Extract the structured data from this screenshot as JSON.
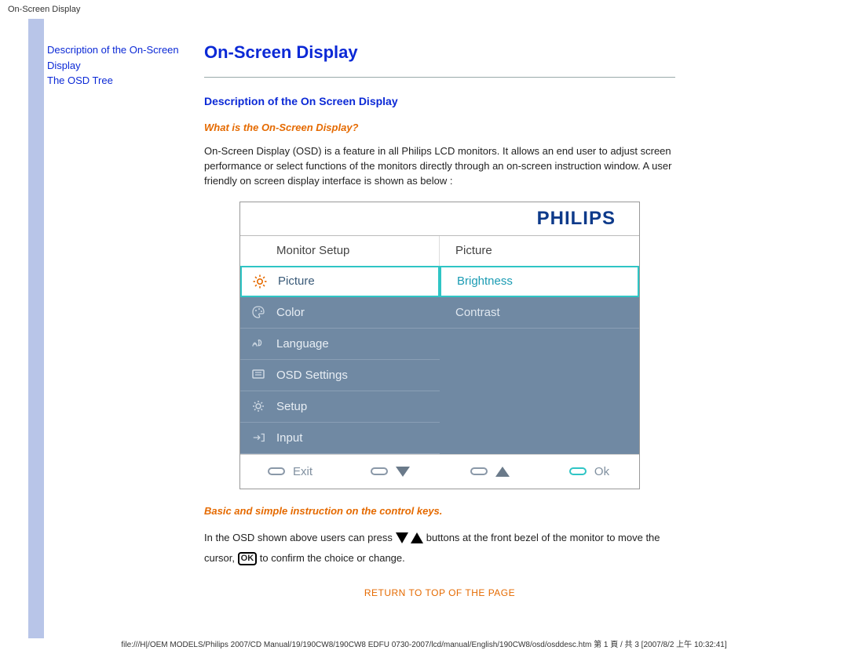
{
  "header": {
    "title": "On-Screen Display"
  },
  "sidebar": {
    "links": [
      "Description of the On-Screen Display",
      "The OSD Tree"
    ]
  },
  "main": {
    "h1": "On-Screen Display",
    "h2": "Description of the On Screen Display",
    "q_heading": "What is the On-Screen Display?",
    "intro": "On-Screen Display (OSD) is a feature in all Philips LCD monitors. It allows an end user to adjust screen performance or select functions of the monitors directly through an on-screen instruction window. A user friendly on screen display interface is shown as below :",
    "instructions_heading": "Basic and simple instruction on the control keys.",
    "instr_1": "In the OSD shown above users can press",
    "instr_2": " buttons at the front bezel of the monitor to move the cursor,",
    "instr_3": " to confirm the choice or change.",
    "return": "RETURN TO TOP OF THE PAGE"
  },
  "osd": {
    "logo": "PHILIPS",
    "col_left_header": "Monitor Setup",
    "col_right_header": "Picture",
    "menu": [
      {
        "label": "Picture",
        "icon": "brightness-icon",
        "selected": true
      },
      {
        "label": "Color",
        "icon": "color-icon",
        "selected": false
      },
      {
        "label": "Language",
        "icon": "language-icon",
        "selected": false
      },
      {
        "label": "OSD Settings",
        "icon": "osd-settings-icon",
        "selected": false
      },
      {
        "label": "Setup",
        "icon": "setup-icon",
        "selected": false
      },
      {
        "label": "Input",
        "icon": "input-icon",
        "selected": false
      }
    ],
    "submenu": [
      {
        "label": "Brightness",
        "selected": true
      },
      {
        "label": "Contrast",
        "selected": false
      }
    ],
    "footer": {
      "exit": "Exit",
      "ok": "Ok"
    }
  },
  "footer_path": "file:///H|/OEM MODELS/Philips 2007/CD Manual/19/190CW8/190CW8 EDFU 0730-2007/lcd/manual/English/190CW8/osd/osddesc.htm 第 1 頁 / 共 3  [2007/8/2 上午 10:32:41]"
}
